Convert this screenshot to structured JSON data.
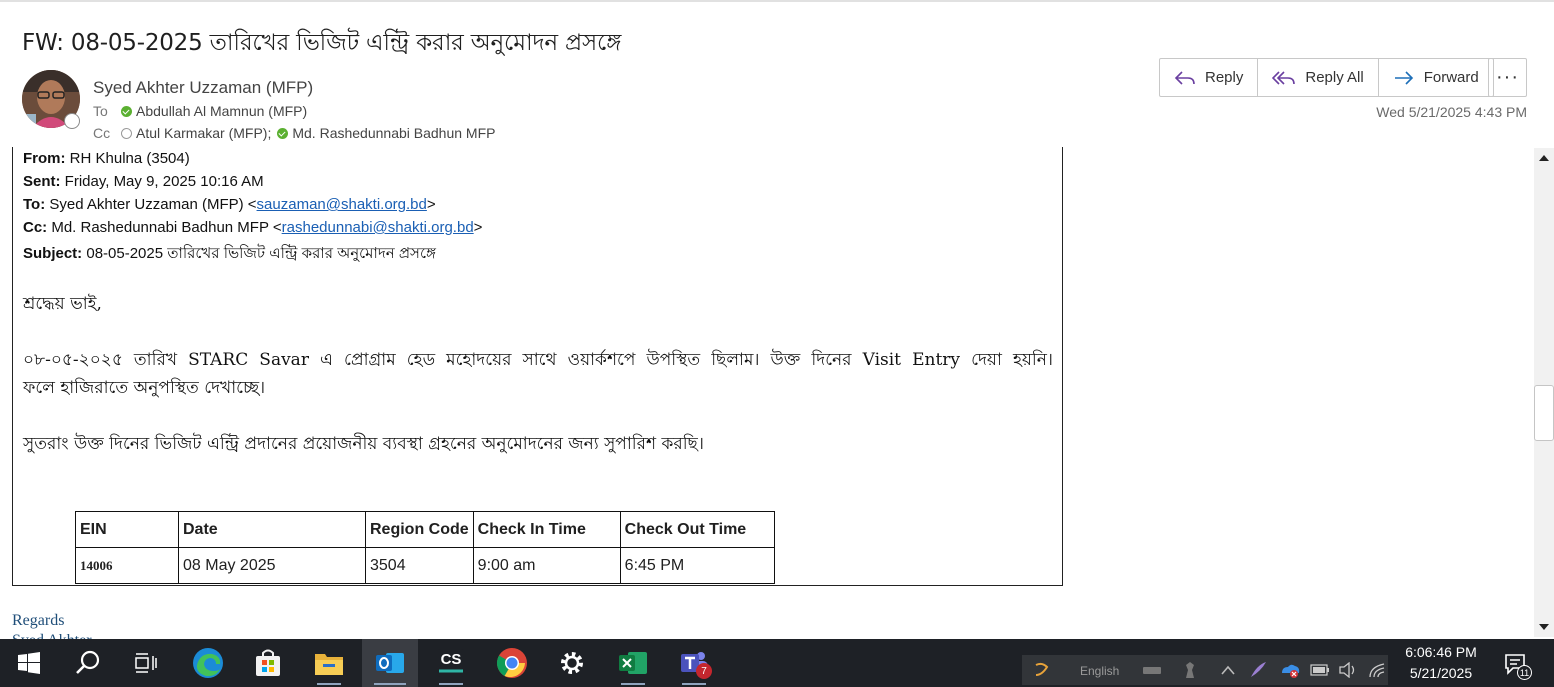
{
  "email": {
    "subject": "FW: 08-05-2025 তারিখের ভিজিট এন্ট্রি করার অনুমোদন প্রসঙ্গে",
    "sender": "Syed Akhter Uzzaman (MFP)",
    "to_label": "To",
    "to": "Abdullah Al Mamnun (MFP)",
    "cc_label": "Cc",
    "cc_1": "Atul  Karmakar (MFP);",
    "cc_2": "Md. Rashedunnabi Badhun MFP",
    "datetime": "Wed 5/21/2025 4:43 PM"
  },
  "actions": {
    "reply": "Reply",
    "reply_all": "Reply All",
    "forward": "Forward",
    "more": "···"
  },
  "forwarded": {
    "from_label": "From:",
    "from_value": " RH Khulna (3504)",
    "sent_label": "Sent:",
    "sent_value": " Friday, May 9, 2025 10:16 AM",
    "to_label": "To:",
    "to_value": " Syed Akhter Uzzaman (MFP) <",
    "to_email": "sauzaman@shakti.org.bd",
    "cc_label": "Cc:",
    "cc_value": " Md. Rashedunnabi Badhun MFP <",
    "cc_email": "rashedunnabi@shakti.org.bd",
    "subject_label": "Subject:",
    "subject_value": " 08-05-2025 তারিখের ভিজিট এন্ট্রি করার অনুমোদন প্রসঙ্গে",
    "close_angle": ">"
  },
  "body": {
    "greeting": "শ্রদ্ধেয় ভাই,",
    "para1_line1": "০৮-০৫-২০২৫ তারিখ STARC Savar এ প্রোগ্রাম হেড মহোদয়ের সাথে ওয়ার্কশপে উপস্থিত ছিলাম। উক্ত দিনের Visit Entry দেয়া হয়নি।",
    "para1_line2": "ফলে হাজিরাতে অনুপস্থিত দেখাচ্ছে।",
    "para2": "সুতরাং উক্ত দিনের ভিজিট এন্ট্রি প্রদানের প্রয়োজনীয় ব্যবস্থা গ্রহনের অনুমোদনের জন্য সুপারিশ করছি।"
  },
  "table": {
    "headers": [
      "EIN",
      "Date",
      "Region Code",
      "Check In Time",
      "Check Out Time"
    ],
    "row": [
      "14006",
      "08 May 2025",
      "3504",
      "9:00 am",
      "6:45 PM"
    ]
  },
  "signature": {
    "regards": "Regards",
    "name_partial": "Syed Akhter"
  },
  "taskbar": {
    "apps": [
      "start-icon",
      "search-icon",
      "task-view-icon",
      "edge-icon",
      "store-icon",
      "file-explorer-icon",
      "outlook-icon",
      "cs-icon",
      "chrome-icon",
      "settings-icon",
      "excel-icon",
      "teams-icon"
    ],
    "cs_label": "CS",
    "teams_badge": "7",
    "tray_language": "English",
    "time": "6:06:46 PM",
    "date": "5/21/2025",
    "notification_count": "11"
  },
  "colors": {
    "link": "#1a5fb4",
    "presence_green": "#5bb031",
    "taskbar": "#1e2126",
    "signature": "#1f4e79"
  }
}
